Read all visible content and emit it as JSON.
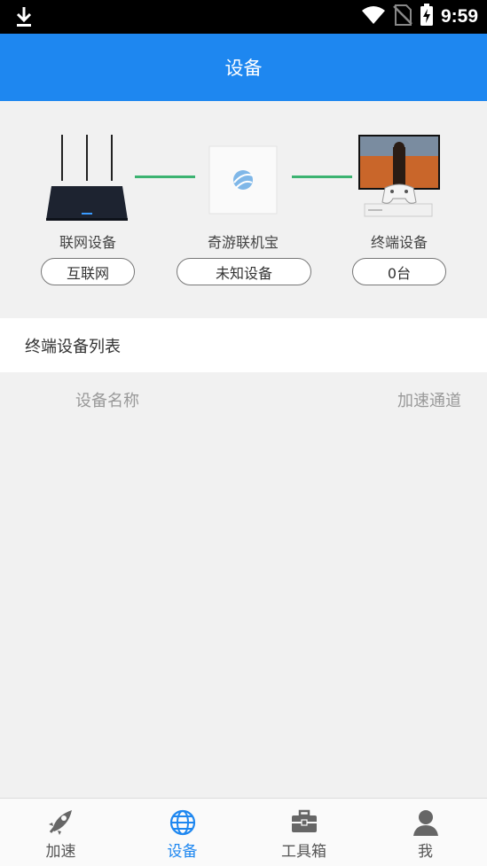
{
  "status_bar": {
    "time": "9:59"
  },
  "header": {
    "title": "设备"
  },
  "topology": {
    "network": {
      "label": "联网设备",
      "value": "互联网"
    },
    "box": {
      "label": "奇游联机宝",
      "value": "未知设备"
    },
    "terminal": {
      "label": "终端设备",
      "value": "0台"
    }
  },
  "device_list": {
    "title": "终端设备列表",
    "columns": [
      "设备名称",
      "加速通道"
    ]
  },
  "bottom_nav": {
    "items": [
      {
        "label": "加速",
        "icon": "rocket-icon",
        "active": false
      },
      {
        "label": "设备",
        "icon": "globe-icon",
        "active": true
      },
      {
        "label": "工具箱",
        "icon": "toolbox-icon",
        "active": false
      },
      {
        "label": "我",
        "icon": "person-icon",
        "active": false
      }
    ]
  },
  "colors": {
    "accent": "#1e87f0",
    "connector": "#3cb371"
  }
}
